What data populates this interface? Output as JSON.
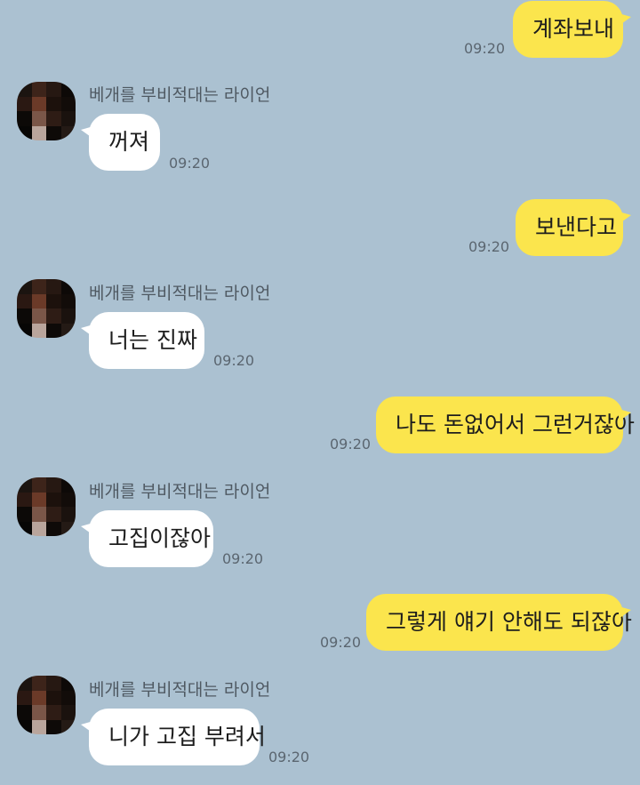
{
  "contact": {
    "name": "베개를 부비적대는 라이언"
  },
  "messages": [
    {
      "sender": "me",
      "text": "계좌보내",
      "time": "09:20"
    },
    {
      "sender": "other",
      "text": "꺼져",
      "time": "09:20"
    },
    {
      "sender": "me",
      "text": "보낸다고",
      "time": "09:20"
    },
    {
      "sender": "other",
      "text": "너는 진짜",
      "time": "09:20"
    },
    {
      "sender": "me",
      "text": "나도 돈없어서 그런거잖아",
      "time": "09:20"
    },
    {
      "sender": "other",
      "text": "고집이잖아",
      "time": "09:20"
    },
    {
      "sender": "me",
      "text": "그렇게 얘기 안해도 되잖아",
      "time": "09:20"
    },
    {
      "sender": "other",
      "text": "니가 고집 부려서",
      "time": "09:20"
    }
  ],
  "colors": {
    "background": "#abc1d1",
    "my_bubble": "#fbe54d",
    "their_bubble": "#ffffff"
  }
}
